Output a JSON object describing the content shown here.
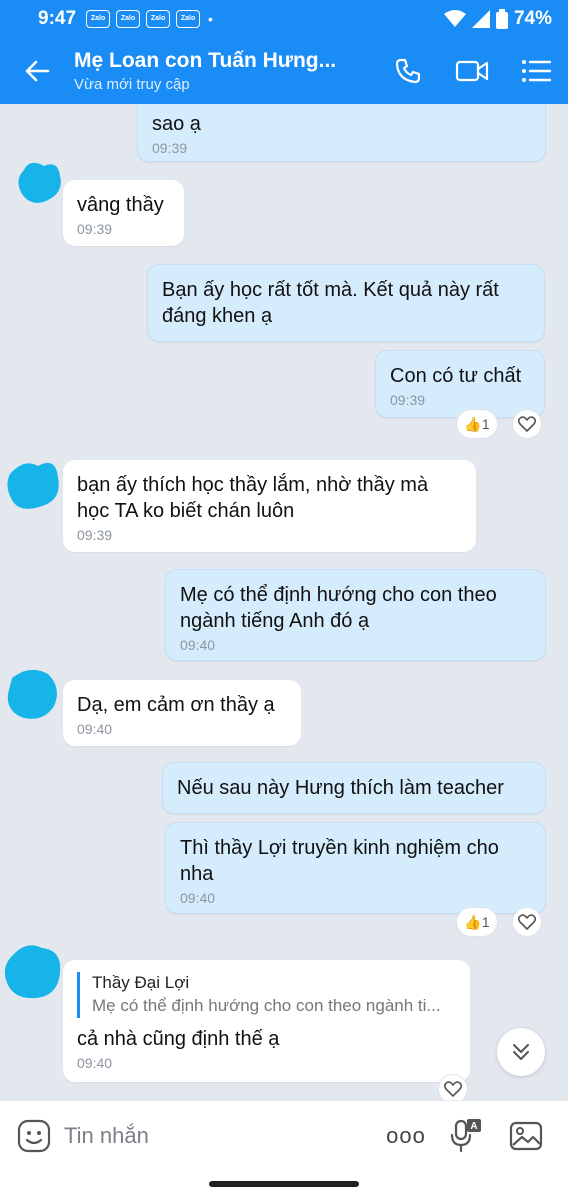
{
  "status_bar": {
    "time": "9:47",
    "notification_labels": [
      "Zalo",
      "Zalo",
      "Zalo",
      "Zalo"
    ],
    "dot": "•",
    "battery": "74%"
  },
  "header": {
    "contact_name": "Mẹ Loan con Tuấn Hưng...",
    "contact_status": "Vừa mới truy cập",
    "icons": [
      "back-arrow-icon",
      "phone-icon",
      "video-call-icon",
      "menu-list-icon"
    ]
  },
  "messages": [
    {
      "direction": "out",
      "text": "sao ạ",
      "time": "09:39"
    },
    {
      "direction": "in",
      "text": "vâng thầy",
      "time": "09:39"
    },
    {
      "direction": "out",
      "text": "Bạn ấy học rất tốt mà. Kết quả này rất đáng khen ạ",
      "time": ""
    },
    {
      "direction": "out",
      "text": "Con có tư chất",
      "time": "09:39",
      "like_count": "1"
    },
    {
      "direction": "in",
      "text": "bạn ấy thích học thầy lắm, nhờ thầy mà học TA ko biết chán luôn",
      "time": "09:39"
    },
    {
      "direction": "out",
      "text": "Mẹ có thể định hướng cho con theo ngành tiếng Anh đó ạ",
      "time": "09:40"
    },
    {
      "direction": "in",
      "text": "Dạ, em cảm ơn thầy ạ",
      "time": "09:40"
    },
    {
      "direction": "out",
      "text": "Nếu sau này Hưng thích làm teacher",
      "time": ""
    },
    {
      "direction": "out",
      "text": "Thì thầy Lợi truyền kinh nghiệm cho nha",
      "time": "09:40",
      "like_count": "1"
    },
    {
      "direction": "in",
      "text": "cả nhà cũng định thế ạ",
      "time": "09:40",
      "quote": {
        "author": "Thầy Đại Lợi",
        "text": "Mẹ có thể định hướng cho con theo ngành ti..."
      }
    }
  ],
  "composer": {
    "placeholder": "Tin nhắn",
    "more_label": "ooo",
    "mic_badge": "A"
  },
  "colors": {
    "brand": "#1a8cf6",
    "chat_background": "#e3e7ee",
    "outgoing_bubble": "#d5ecfc",
    "incoming_bubble": "#ffffff",
    "avatar_blur": "#16b4e8"
  }
}
